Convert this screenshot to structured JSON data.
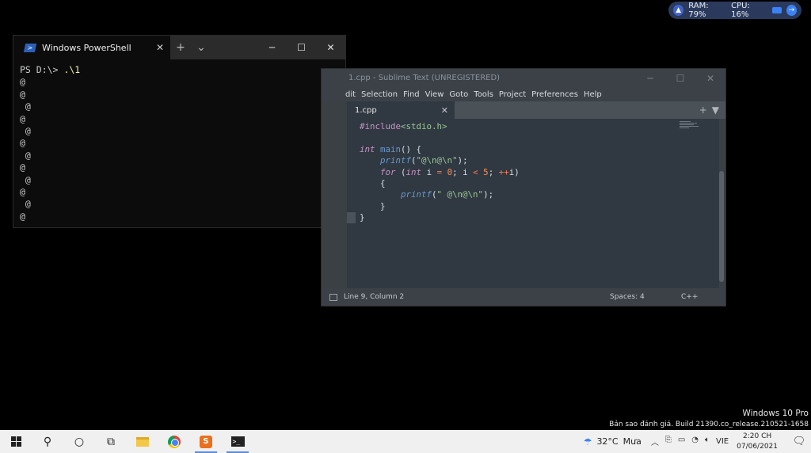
{
  "monitor": {
    "ram": "RAM: 79%",
    "cpu": "CPU: 16%"
  },
  "powershell": {
    "tab_label": "Windows PowerShell",
    "prompt": "PS D:\\> ",
    "command": ".\\1",
    "output_lines": [
      "@",
      "@",
      " @",
      "@",
      " @",
      "@",
      " @",
      "@",
      " @",
      "@",
      " @",
      "@"
    ]
  },
  "sublime": {
    "title": "1.cpp - Sublime Text (UNREGISTERED)",
    "menu": [
      "dit",
      "Selection",
      "Find",
      "View",
      "Goto",
      "Tools",
      "Project",
      "Preferences",
      "Help"
    ],
    "tab": "1.cpp",
    "status": {
      "position": "Line 9, Column 2",
      "spaces": "Spaces: 4",
      "syntax": "C++"
    }
  },
  "watermark": {
    "edition": "Windows 10 Pro",
    "build": "Bản sao đánh giá. Build 21390.co_release.210521-1658"
  },
  "taskbar": {
    "weather_temp": "32°C",
    "weather_text": "Mưa",
    "language": "VIE",
    "time": "2:20 CH",
    "date": "07/06/2021"
  }
}
